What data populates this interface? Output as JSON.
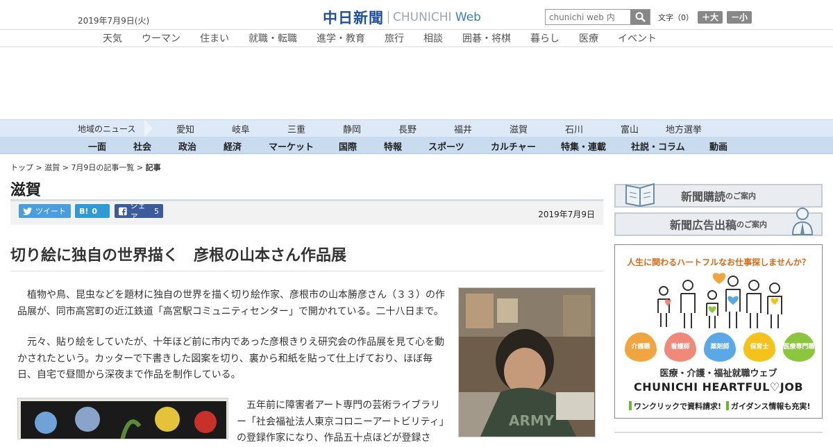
{
  "header": {
    "date": "2019年7月9日(火)",
    "logo_jp": "中日新聞",
    "logo_en_1": "CHUNICHI",
    "logo_en_2": "Web",
    "search_placeholder": "chunichi web 内",
    "font_label": "文字（0）",
    "font_bigger": "＋大",
    "font_smaller": "－小"
  },
  "top_nav": [
    "天気",
    "ウーマン",
    "住まい",
    "就職・転職",
    "進学・教育",
    "旅行",
    "相談",
    "囲碁・将棋",
    "暮らし",
    "医療",
    "イベント"
  ],
  "region_nav": {
    "label": "地域のニュース",
    "items": [
      "愛知",
      "岐阜",
      "三重",
      "静岡",
      "長野",
      "福井",
      "滋賀",
      "石川",
      "富山",
      "地方選挙"
    ]
  },
  "section_nav": [
    "一面",
    "社会",
    "政治",
    "経済",
    "マーケット",
    "国際",
    "特報",
    "スポーツ",
    "カルチャー",
    "特集・連載",
    "社説・コラム",
    "動画"
  ],
  "breadcrumb": {
    "items": [
      "トップ",
      "滋賀",
      "7月9日の記事一覧"
    ],
    "current": "記事",
    "sep": " > "
  },
  "category": "滋賀",
  "share": {
    "tweet": "ツイート",
    "hatena_label": "B!",
    "hatena_count": "0",
    "fb_label": "シェア",
    "fb_count": "5",
    "date": "2019年7月9日"
  },
  "article": {
    "headline": "切り絵に独自の世界描く　彦根の山本さん作品展",
    "p1": "　植物や鳥、昆虫などを題材に独自の世界を描く切り絵作家、彦根市の山本勝彦さん（３３）の作品展が、同市高宮町の近江鉄道「高宮駅コミュニティセンター」で開かれている。二十八日まで。",
    "p2": "　元々、貼り絵をしていたが、十年ほど前に市内であった彦根きりえ研究会の作品展を見て心を動かされたという。カッターで下書きした図案を切り、裏から和紙を貼って仕上げており、ほぼ毎日、自宅で昼間から深夜まで作品を制作している。",
    "p3": "　五年前に障害者アート専門の芸術ライブラリー「社会福祉法人東京コロニーアートビリティ」の登録作家になり、作品五十点ほどが登録さ"
  },
  "sidebar": {
    "ad1_main": "新聞購読",
    "ad1_sub": "のご案内",
    "ad2_main": "新聞広告出稿",
    "ad2_sub": "のご案内",
    "job": {
      "tagline": "人生に関わるハートフルなお仕事探しませんか？",
      "badges": [
        "介護職",
        "看護師",
        "薬剤師",
        "保育士",
        "医療専門職"
      ],
      "badge_colors": [
        "#f0a640",
        "#ef8a7a",
        "#5aa9e6",
        "#f4c21a",
        "#8cc63f"
      ],
      "title": "医療・介護・福祉就職ウェブ",
      "brand": "CHUNICHI HEARTFUL♡JOB",
      "note1": "ワンクリックで資料請求!",
      "note2": "ガイダンス情報も充実!"
    }
  }
}
